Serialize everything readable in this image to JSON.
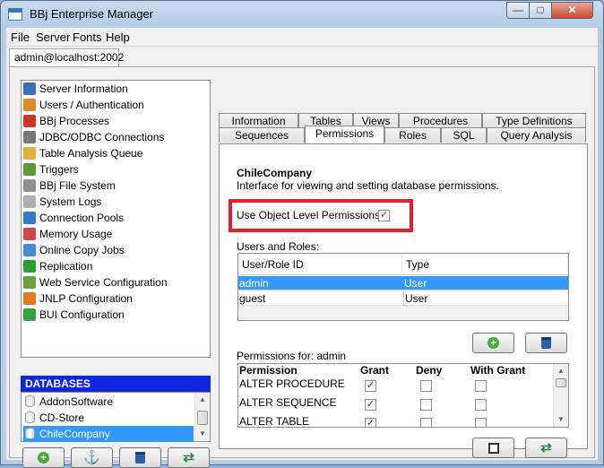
{
  "window": {
    "title": "BBj Enterprise Manager"
  },
  "menu": [
    "File",
    "Server",
    "Fonts",
    "Help"
  ],
  "session_tab": "admin@localhost:2002",
  "tree": [
    {
      "label": "Server Information",
      "icon": "server-info-icon",
      "color": "#3b6fb6"
    },
    {
      "label": "Users / Authentication",
      "icon": "users-icon",
      "color": "#d98b2b"
    },
    {
      "label": "BBj Processes",
      "icon": "processes-icon",
      "color": "#c7352b"
    },
    {
      "label": "JDBC/ODBC Connections",
      "icon": "connections-icon",
      "color": "#7a7a7a"
    },
    {
      "label": "Table Analysis Queue",
      "icon": "magnifier-icon",
      "color": "#e0b040"
    },
    {
      "label": "Triggers",
      "icon": "triggers-icon",
      "color": "#5a9a3a"
    },
    {
      "label": "BBj File System",
      "icon": "file-system-icon",
      "color": "#909090"
    },
    {
      "label": "System Logs",
      "icon": "logs-icon",
      "color": "#b0b0b0"
    },
    {
      "label": "Connection Pools",
      "icon": "pools-icon",
      "color": "#3a78c8"
    },
    {
      "label": "Memory Usage",
      "icon": "memory-icon",
      "color": "#d04848"
    },
    {
      "label": "Online Copy Jobs",
      "icon": "copy-jobs-icon",
      "color": "#4a8ad0"
    },
    {
      "label": "Replication",
      "icon": "replication-icon",
      "color": "#2f9a3a"
    },
    {
      "label": "Web Service Configuration",
      "icon": "web-service-icon",
      "color": "#6aa040"
    },
    {
      "label": "JNLP Configuration",
      "icon": "jnlp-icon",
      "color": "#e07b20"
    },
    {
      "label": "BUI Configuration",
      "icon": "bui-icon",
      "color": "#35a045"
    }
  ],
  "databases": {
    "header": "DATABASES",
    "items": [
      "AddonSoftware",
      "CD-Store",
      "ChileCompany"
    ],
    "selected": "ChileCompany"
  },
  "tabs": {
    "row1": [
      "Information",
      "Tables",
      "Views",
      "Procedures",
      "Type Definitions"
    ],
    "row2": [
      "Sequences",
      "Permissions",
      "Roles",
      "SQL",
      "Query Analysis"
    ],
    "active": "Permissions"
  },
  "permissions": {
    "db_name": "ChileCompany",
    "description": "Interface for viewing and setting database permissions.",
    "object_level_label": "Use Object Level Permissions:",
    "object_level_checked": true,
    "users_label": "Users and Roles:",
    "users_columns": [
      "User/Role ID",
      "Type"
    ],
    "users_rows": [
      {
        "id": "admin",
        "type": "User",
        "selected": true
      },
      {
        "id": "guest",
        "type": "User",
        "selected": false
      }
    ],
    "perms_for_label": "Permissions for: admin",
    "perm_columns": [
      "Permission",
      "Grant",
      "Deny",
      "With Grant"
    ],
    "perm_rows": [
      {
        "name": "ALTER PROCEDURE",
        "grant": true,
        "deny": false,
        "with_grant": false
      },
      {
        "name": "ALTER SEQUENCE",
        "grant": true,
        "deny": false,
        "with_grant": false
      },
      {
        "name": "ALTER TABLE",
        "grant": true,
        "deny": false,
        "with_grant": false
      }
    ]
  }
}
